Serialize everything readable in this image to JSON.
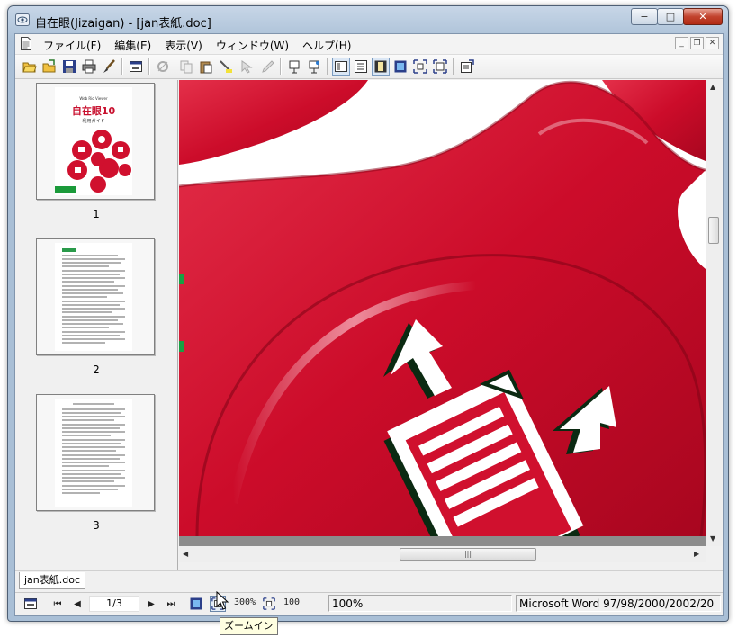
{
  "window": {
    "title": "自在眼(Jizaigan) - [jan表紙.doc]",
    "caption_buttons": {
      "minimize": "−",
      "maximize": "□",
      "close": "✕"
    }
  },
  "menu": {
    "items": [
      {
        "label": "ファイル(F)"
      },
      {
        "label": "編集(E)"
      },
      {
        "label": "表示(V)"
      },
      {
        "label": "ウィンドウ(W)"
      },
      {
        "label": "ヘルプ(H)"
      }
    ],
    "mdi_buttons": {
      "minimize": "_",
      "restore": "❐",
      "close": "✕"
    }
  },
  "toolbar": {
    "icons": [
      "open-folder-icon",
      "open-file-icon",
      "save-icon",
      "print-icon",
      "brush-icon",
      "window-icon",
      "scanner-icon",
      "copy-icon",
      "paste-icon",
      "highlight-icon",
      "select-icon",
      "eyedropper-icon",
      "bookmark-icon",
      "bookmark-add-icon",
      "thumbnail-view-icon",
      "list-view-icon",
      "single-page-view-icon",
      "fit-page-icon",
      "zoom-fit-icon",
      "zoom-in-toolbar-icon",
      "properties-icon"
    ]
  },
  "thumbnails": [
    {
      "number": "1",
      "cover_small": "Web Rio Viewer",
      "cover_title": "自在眼10",
      "cover_subtitle": "利用ガイド"
    },
    {
      "number": "2"
    },
    {
      "number": "3"
    }
  ],
  "document_tab": {
    "label": "jan表紙.doc"
  },
  "status": {
    "page_indicator": "1/3",
    "zoom_300": "300%",
    "zoom_100": "100",
    "zoom_level": "100%",
    "format": "Microsoft Word 97/98/2000/2002/20"
  },
  "tooltip": {
    "text": "ズームイン"
  },
  "colors": {
    "accent_red": "#d0102e",
    "toolbar_bg": "#f0f0f0",
    "title_blue": "#a9bfd6"
  }
}
